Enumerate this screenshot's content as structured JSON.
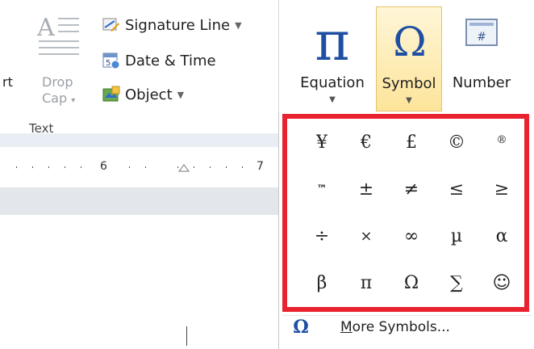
{
  "ribbon": {
    "text_group": {
      "label": "Text",
      "art_label": "rt",
      "drop_cap_line1": "Drop",
      "drop_cap_line2": "Cap",
      "signature_line": "Signature Line",
      "date_time": "Date & Time",
      "object": "Object"
    },
    "symbols_group": {
      "equation": "Equation",
      "symbol": "Symbol",
      "number": "Number"
    }
  },
  "ruler": {
    "mark_6": "6",
    "mark_7": "7"
  },
  "symbol_gallery": {
    "rows": [
      [
        "¥",
        "€",
        "£",
        "©",
        "®"
      ],
      [
        "™",
        "±",
        "≠",
        "≤",
        "≥"
      ],
      [
        "÷",
        "×",
        "∞",
        "µ",
        "α"
      ],
      [
        "β",
        "π",
        "Ω",
        "∑",
        "☺"
      ]
    ],
    "more_symbols": "More Symbols...",
    "more_symbols_accel": "M",
    "more_symbols_rest": "ore Symbols..."
  },
  "colors": {
    "highlight_border": "#e8222e",
    "symbol_button_bg": "#fde49a",
    "omega_icon": "#1e4fa3"
  }
}
